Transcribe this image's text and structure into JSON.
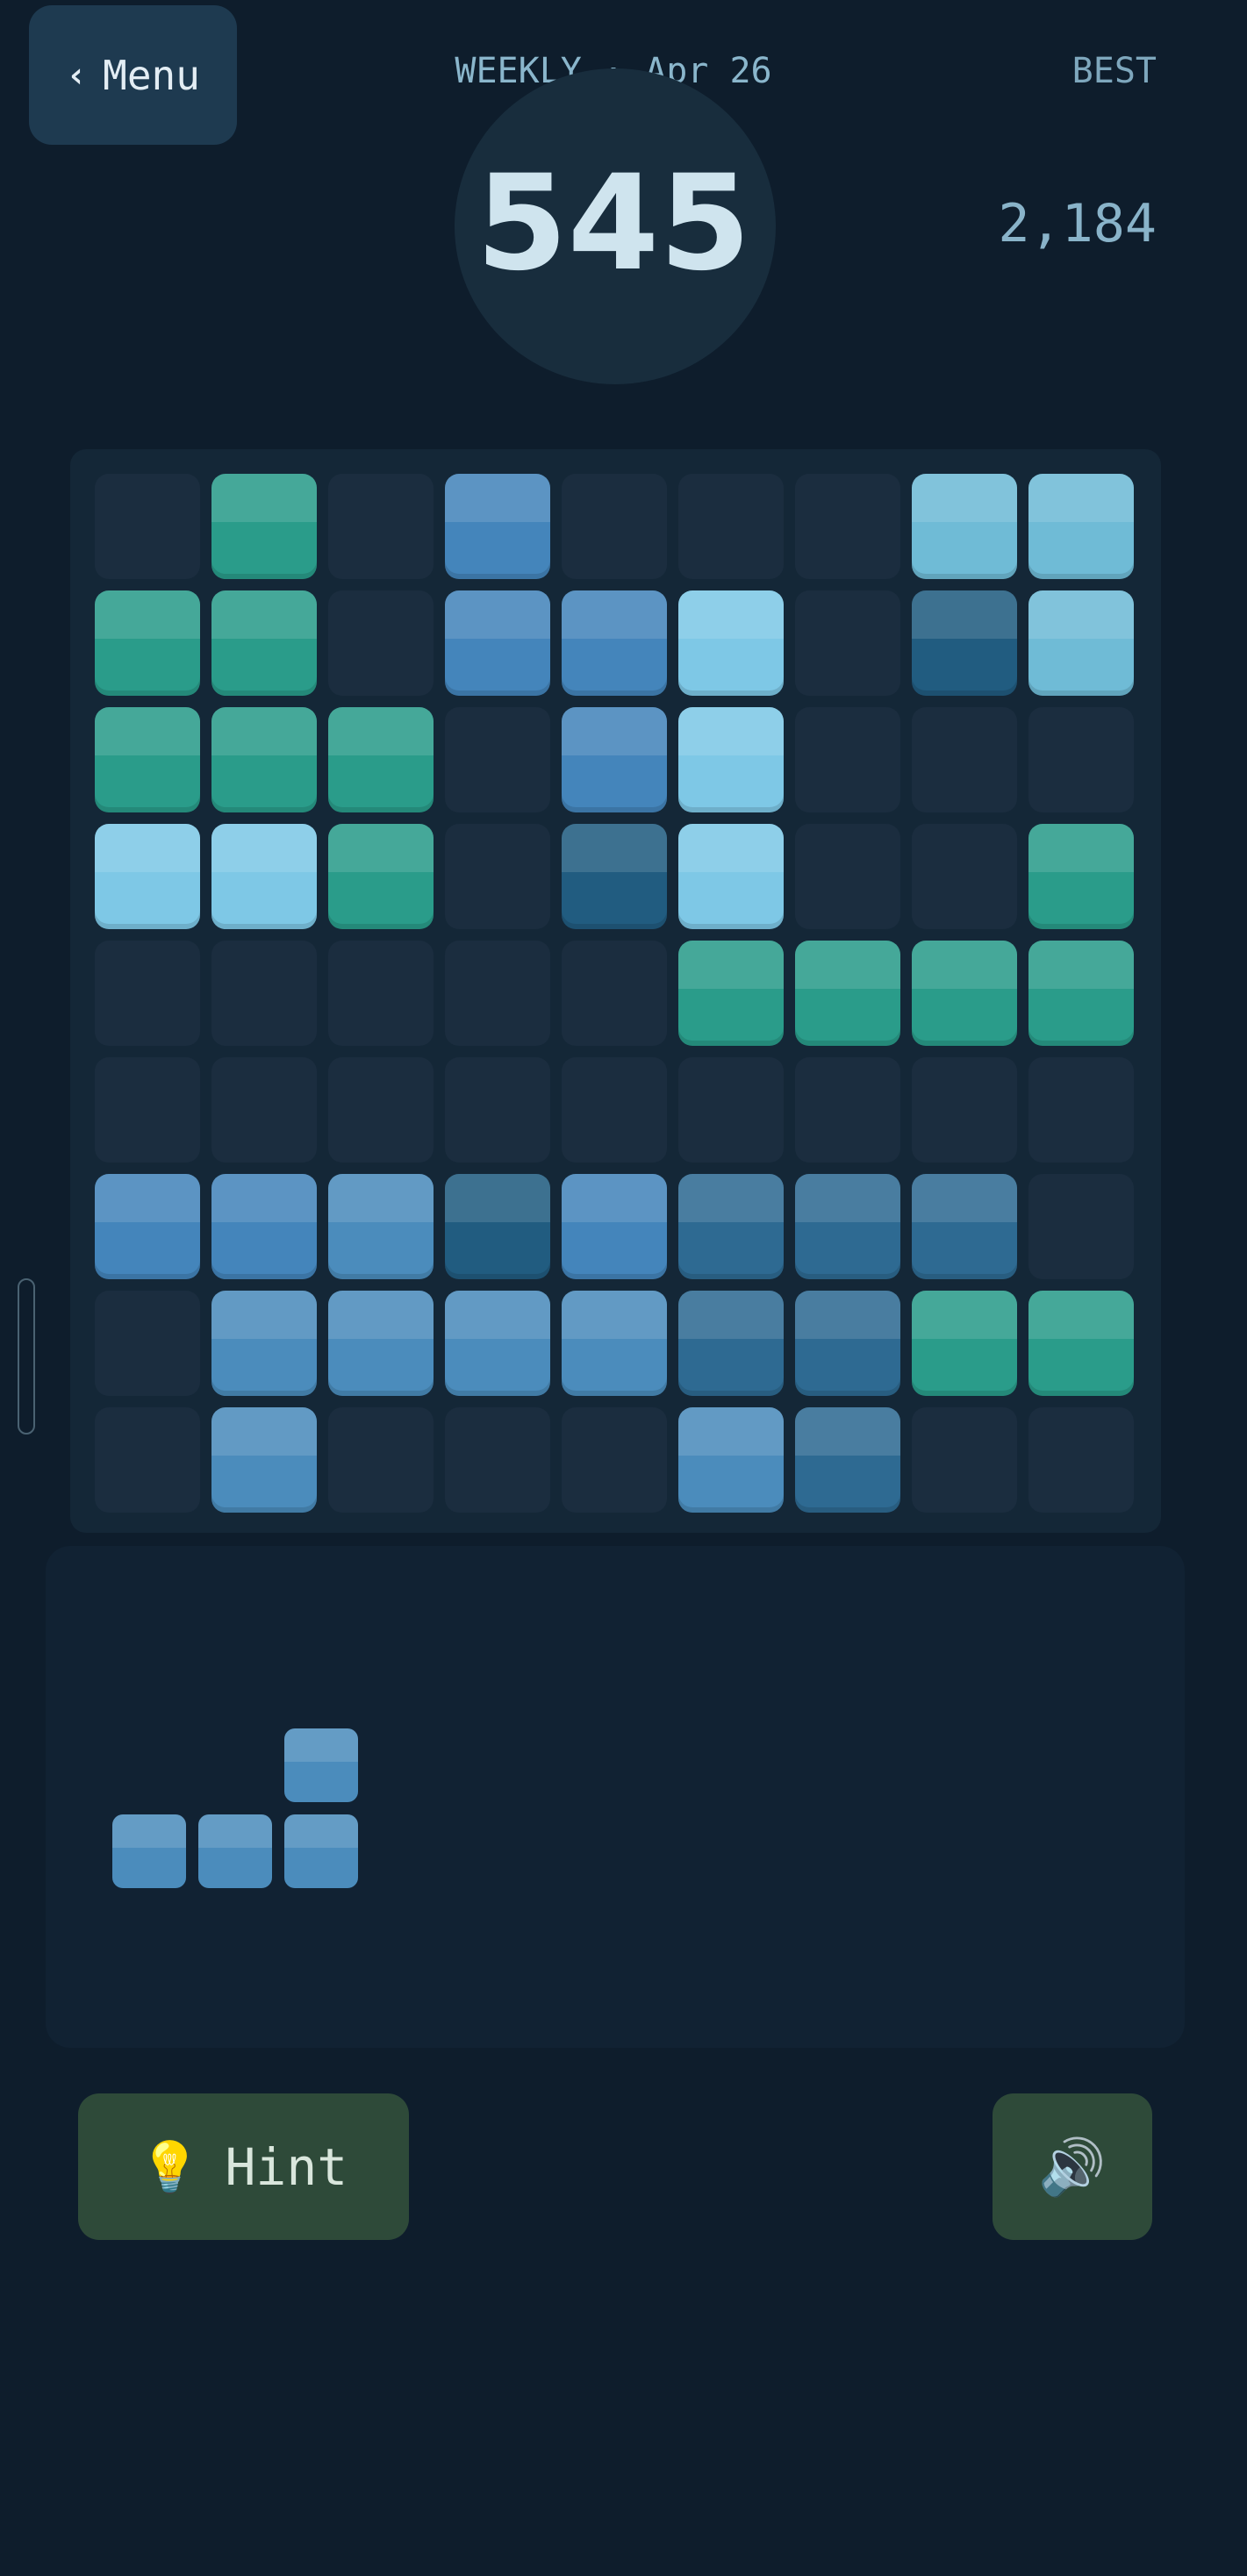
{
  "header": {
    "menu_label": "Menu",
    "menu_icon": "chevron-left-icon",
    "mode_label": "WEEKLY · Apr 26",
    "score": "545",
    "best_label": "BEST",
    "best_value": "2,184"
  },
  "colors": {
    "background": "#0e1d2c",
    "empty_cell": "#1b2d3f",
    "button_green": "#2e4a39",
    "teal": "#2a9c8a",
    "sky": "#7ec8e6",
    "blue": "#4485bb",
    "steel": "#4b8cbc",
    "dark_blue": "#2a6690",
    "navy": "#1f5a80"
  },
  "board": {
    "rows": [
      [
        ".",
        "T",
        ".",
        "B",
        ".",
        ".",
        ".",
        "C",
        "C"
      ],
      [
        "T",
        "T",
        ".",
        "B",
        "B",
        "S",
        ".",
        "N",
        "C"
      ],
      [
        "T",
        "T",
        "T",
        ".",
        "B",
        "S",
        ".",
        ".",
        "."
      ],
      [
        "S",
        "S",
        "T",
        ".",
        "N",
        "S",
        ".",
        ".",
        "T"
      ],
      [
        ".",
        ".",
        ".",
        ".",
        ".",
        "T",
        "T",
        "T",
        "T"
      ],
      [
        ".",
        ".",
        ".",
        ".",
        ".",
        ".",
        ".",
        ".",
        "."
      ],
      [
        "B",
        "B",
        "L",
        "N",
        "B",
        "D",
        "D",
        "D",
        "."
      ],
      [
        ".",
        "L",
        "L",
        "L",
        "L",
        "D",
        "D",
        "T",
        "T"
      ],
      [
        ".",
        "L",
        ".",
        ".",
        ".",
        "L",
        "D",
        ".",
        "."
      ]
    ],
    "legend": {
      "T": "#2a9c8a",
      "S": "#7ec8e6",
      "C": "#6fbbd6",
      "B": "#4485bb",
      "L": "#4b8cbc",
      "D": "#2e6a92",
      "N": "#215c80"
    }
  },
  "tray": {
    "piece": {
      "shape": [
        [
          ".",
          ".",
          "X"
        ],
        [
          "X",
          "X",
          "X"
        ]
      ],
      "color": "#4b8cbc"
    }
  },
  "controls": {
    "hint_label": "Hint",
    "hint_icon": "lightbulb-icon",
    "sound_icon": "speaker-icon"
  }
}
